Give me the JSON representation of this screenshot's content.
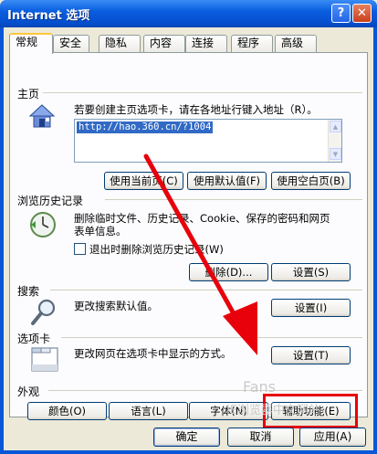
{
  "window": {
    "title": "Internet 选项",
    "help_label": "?",
    "close_label": "✕"
  },
  "tabs": [
    "常规",
    "安全",
    "隐私",
    "内容",
    "连接",
    "程序",
    "高级"
  ],
  "home": {
    "title": "主页",
    "description": "若要创建主页选项卡，请在各地址行键入地址（R）。",
    "url": "http://hao.360.cn/?1004",
    "buttons": [
      "使用当前页(C)",
      "使用默认值(F)",
      "使用空白页(B)"
    ]
  },
  "history": {
    "title": "浏览历史记录",
    "description_line1": "删除临时文件、历史记录、Cookie、保存的密码和网页",
    "description_line2": "表单信息。",
    "checkbox_label": "退出时删除浏览历史记录(W)",
    "delete_button": "删除(D)...",
    "settings_button": "设置(S)"
  },
  "search": {
    "title": "搜索",
    "description": "更改搜索默认值。",
    "settings_button": "设置(I)"
  },
  "tabs_section": {
    "title": "选项卡",
    "description": "更改网页在选项卡中显示的方式。",
    "settings_button": "设置(T)"
  },
  "appearance": {
    "title": "外观",
    "buttons": [
      "颜色(O)",
      "语言(L)",
      "字体(N)",
      "辅助功能(E)"
    ]
  },
  "watermark": {
    "line1": "Fans",
    "line2": "IE浏览器中文网站"
  },
  "footer": {
    "ok": "确定",
    "cancel": "取消",
    "apply": "应用(A)"
  },
  "annotation_color": "#e8000b"
}
